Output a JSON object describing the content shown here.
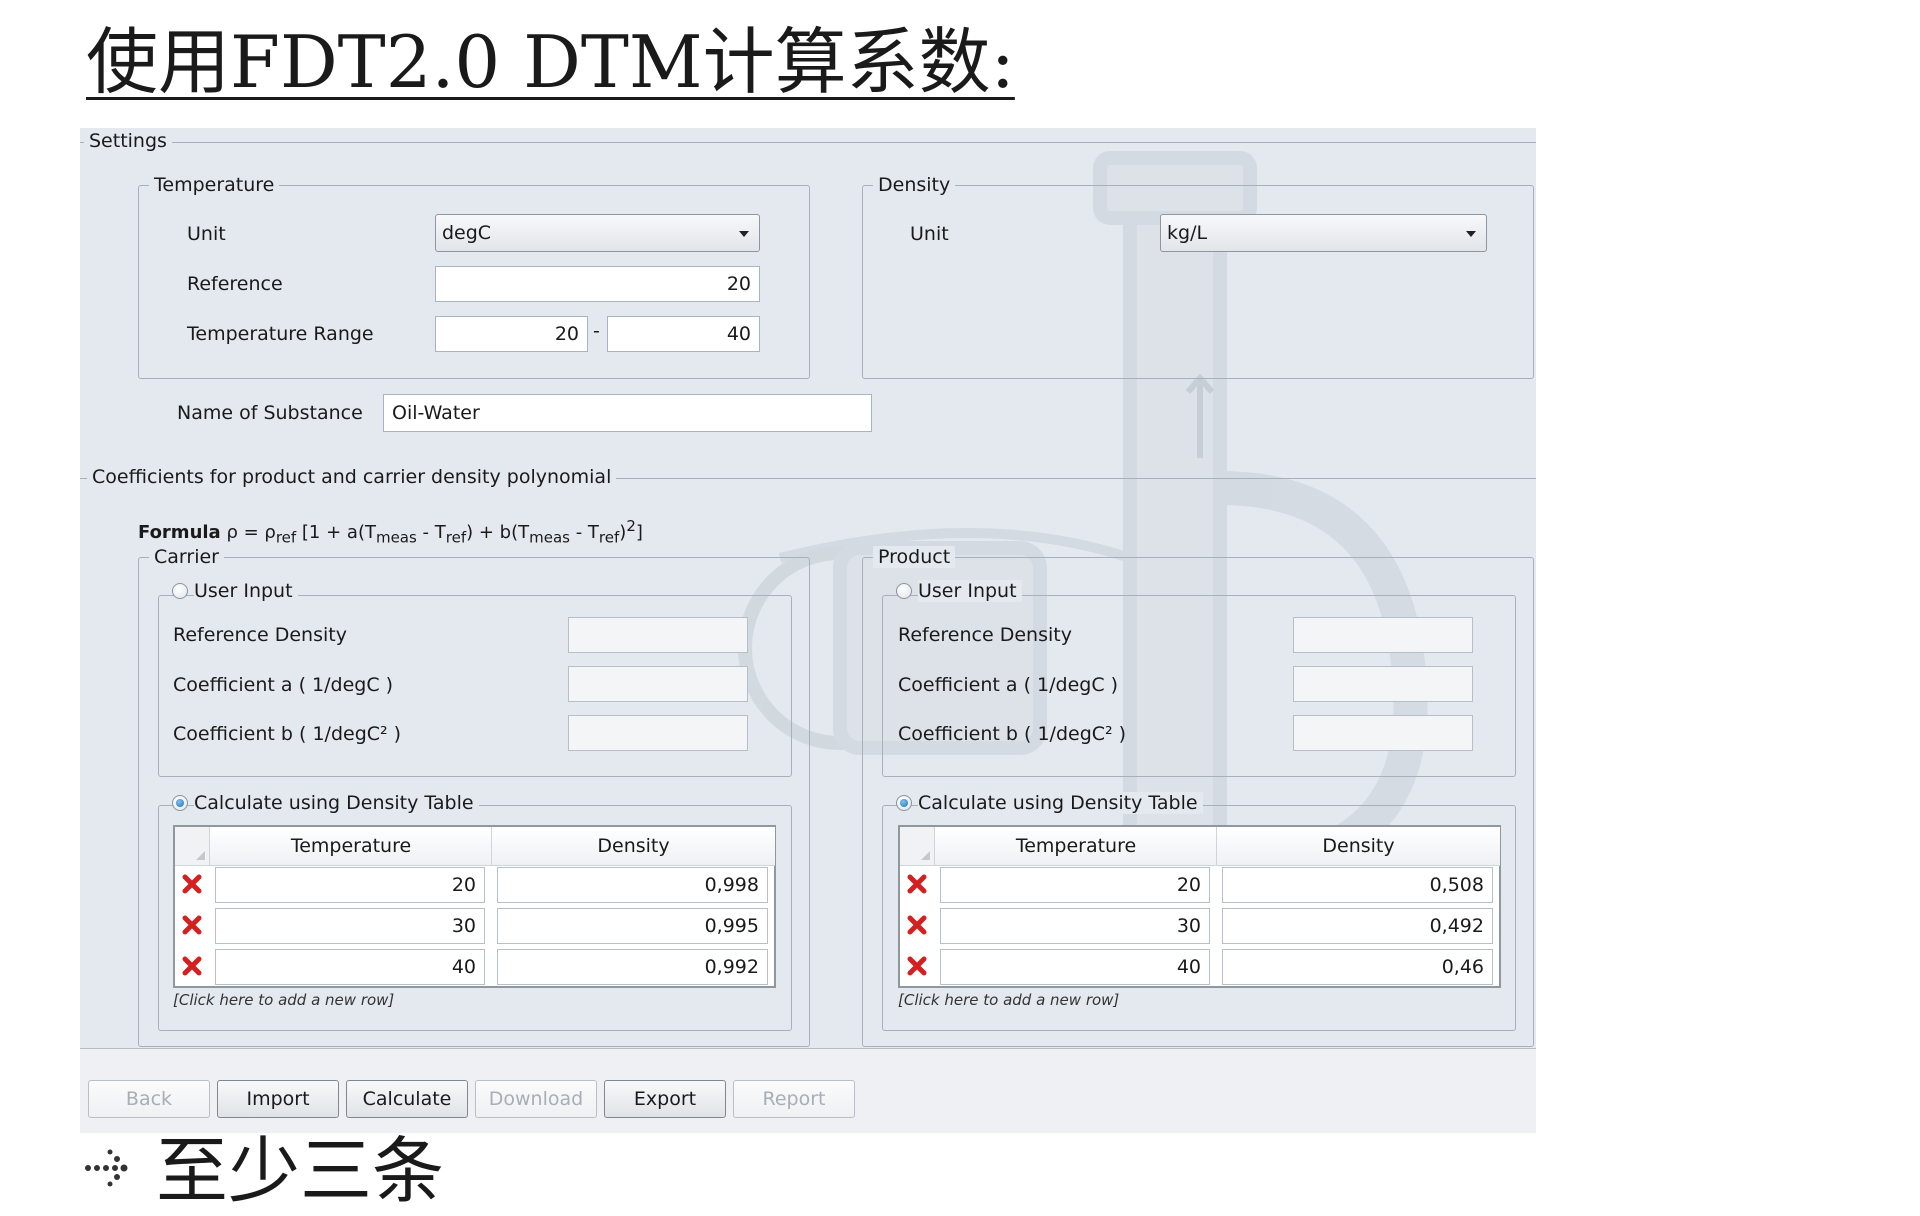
{
  "slide": {
    "title": "使用FDT2.0 DTM计算系数:",
    "bullet_icon": "dotted-arrow-bullet-icon",
    "bullet": "至少三条"
  },
  "settings": {
    "section_label": "Settings",
    "temperature": {
      "group_label": "Temperature",
      "unit_label": "Unit",
      "unit_value": "degC",
      "reference_label": "Reference",
      "reference_value": "20",
      "range_label": "Temperature Range",
      "range_from": "20",
      "range_sep": "-",
      "range_to": "40"
    },
    "density": {
      "group_label": "Density",
      "unit_label": "Unit",
      "unit_value": "kg/L"
    },
    "substance_label": "Name of Substance",
    "substance_value": "Oil-Water"
  },
  "coefficients": {
    "section_label": "Coefficients for product and carrier density polynomial",
    "formula": {
      "bold": "Formula",
      "rho": "ρ = ρ",
      "ref1": "ref",
      "open": " [1 + a(T",
      "meas1": "meas",
      "mid1": " - T",
      "ref2": "ref",
      "mid2": ") + b(T",
      "meas2": "meas",
      "mid3": " - T",
      "ref3": "ref",
      "close": ")",
      "power": "2",
      "end": "]"
    },
    "panels": [
      {
        "group_label": "Carrier",
        "user_input": {
          "label": "User Input",
          "selected": false,
          "reference_density_label": "Reference Density",
          "coef_a_label": "Coefficient a ( 1/degC )",
          "coef_b_label": "Coefficient b ( 1/degC² )"
        },
        "table": {
          "label": "Calculate using Density Table",
          "selected": true,
          "headers": [
            "Temperature",
            "Density"
          ],
          "rows": [
            [
              "20",
              "0,998"
            ],
            [
              "30",
              "0,995"
            ],
            [
              "40",
              "0,992"
            ]
          ],
          "add_row": "[Click here to add a new row]"
        }
      },
      {
        "group_label": "Product",
        "user_input": {
          "label": "User Input",
          "selected": false,
          "reference_density_label": "Reference Density",
          "coef_a_label": "Coefficient a ( 1/degC )",
          "coef_b_label": "Coefficient b ( 1/degC² )"
        },
        "table": {
          "label": "Calculate using Density Table",
          "selected": true,
          "headers": [
            "Temperature",
            "Density"
          ],
          "rows": [
            [
              "20",
              "0,508"
            ],
            [
              "30",
              "0,492"
            ],
            [
              "40",
              "0,46"
            ]
          ],
          "add_row": "[Click here to add a new row]"
        }
      }
    ]
  },
  "toolbar": {
    "back": "Back",
    "import": "Import",
    "calculate": "Calculate",
    "download": "Download",
    "export": "Export",
    "report": "Report"
  },
  "colors": {
    "panel_bg": "#e4e9ef",
    "delete_icon": "#d42020",
    "radio_selected": "#1f6fb2"
  }
}
